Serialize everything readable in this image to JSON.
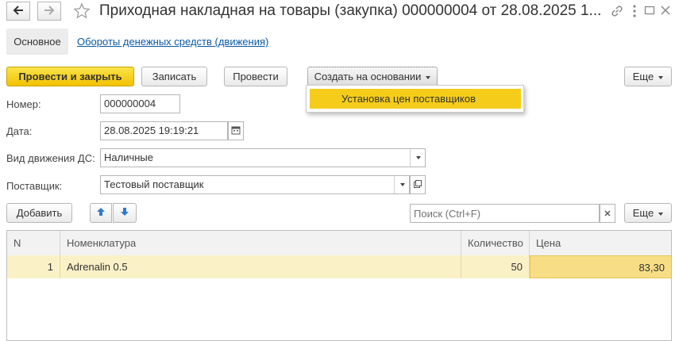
{
  "window": {
    "title": "Приходная накладная на товары (закупка) 000000004 от 28.08.2025 1...",
    "back_icon": "arrow-left-icon",
    "forward_icon": "arrow-right-icon",
    "star_icon": "star-icon",
    "link_icon": "link-icon",
    "menu_icon": "more-vertical-icon",
    "maximize_icon": "maximize-icon",
    "close_icon": "close-icon"
  },
  "tabs": {
    "main": "Основное",
    "cash_flows": "Обороты денежных средств (движения)"
  },
  "toolbar": {
    "post_and_close": "Провести и закрыть",
    "save": "Записать",
    "post": "Провести",
    "create_based_on": "Создать на основании",
    "more": "Еще"
  },
  "dropdown": {
    "items": [
      "Установка цен поставщиков"
    ]
  },
  "form": {
    "number_label": "Номер:",
    "number_value": "000000004",
    "date_label": "Дата:",
    "date_value": "28.08.2025 19:19:21",
    "movement_label": "Вид движения ДС:",
    "movement_value": "Наличные",
    "supplier_label": "Поставщик:",
    "supplier_value": "Тестовый поставщик"
  },
  "table_toolbar": {
    "add": "Добавить",
    "search_placeholder": "Поиск (Ctrl+F)",
    "more": "Еще"
  },
  "table": {
    "columns": [
      "N",
      "Номенклатура",
      "Количество",
      "Цена"
    ],
    "rows": [
      {
        "n": "1",
        "item": "Adrenalin 0.5",
        "qty": "50",
        "price": "83,30"
      }
    ]
  },
  "colors": {
    "accent_yellow": "#f5cc1a",
    "row_highlight": "#fbf1c7",
    "link_blue": "#0c5aa6"
  }
}
